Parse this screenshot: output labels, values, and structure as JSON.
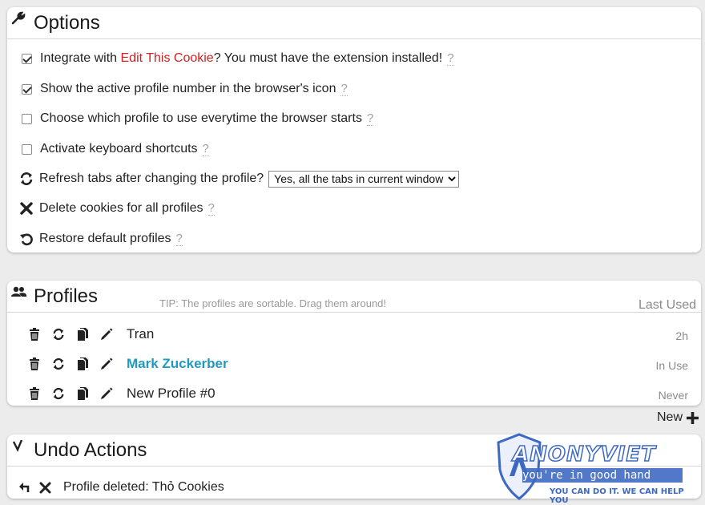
{
  "options": {
    "title": "Options",
    "integrate": {
      "prefix": "Integrate with ",
      "link": "Edit This Cookie",
      "suffix": "? You must have the extension installed!",
      "checked": true
    },
    "show_number": {
      "label": "Show the active profile number in the browser's icon",
      "checked": true
    },
    "choose_profile": {
      "label": "Choose which profile to use everytime the browser starts",
      "checked": false
    },
    "shortcuts": {
      "label": "Activate keyboard shortcuts",
      "checked": false
    },
    "refresh": {
      "label": "Refresh tabs after changing the profile?",
      "selected": "Yes, all the tabs in current window"
    },
    "delete_cookies": {
      "label": "Delete cookies for all profiles"
    },
    "restore": {
      "label": "Restore default profiles"
    },
    "help_mark": "?"
  },
  "profiles": {
    "title": "Profiles",
    "tip": "TIP: The profiles are sortable. Drag them around!",
    "last_used_header": "Last Used",
    "items": [
      {
        "name": "Tran",
        "status": "2h",
        "active": false
      },
      {
        "name": "Mark Zuckerber",
        "status": "In Use",
        "active": true
      },
      {
        "name": "New Profile #0",
        "status": "Never",
        "active": false
      }
    ],
    "new_label": "New"
  },
  "undo": {
    "title": "Undo Actions",
    "items": [
      {
        "text": "Profile deleted: Thỏ Cookies"
      }
    ]
  },
  "watermark": {
    "brand": "ANONYVIET",
    "slogan": "you're in good hand",
    "tagline": "YOU CAN DO IT. WE CAN HELP YOU"
  },
  "colors": {
    "link_red": "#d21f1f",
    "active_profile": "#1e9ac0",
    "muted": "#8a8a8a",
    "watermark_blue": "#1d4fb8"
  },
  "icons": {
    "options": "wrench-icon",
    "profiles": "users-icon",
    "undo": "undo-arrow-icon",
    "refresh": "refresh-icon",
    "delete": "x-icon",
    "restore": "restore-icon",
    "profile_tools": [
      "trash-icon",
      "swap-icon",
      "copy-icon",
      "pencil-icon"
    ],
    "new": "plus-icon"
  }
}
